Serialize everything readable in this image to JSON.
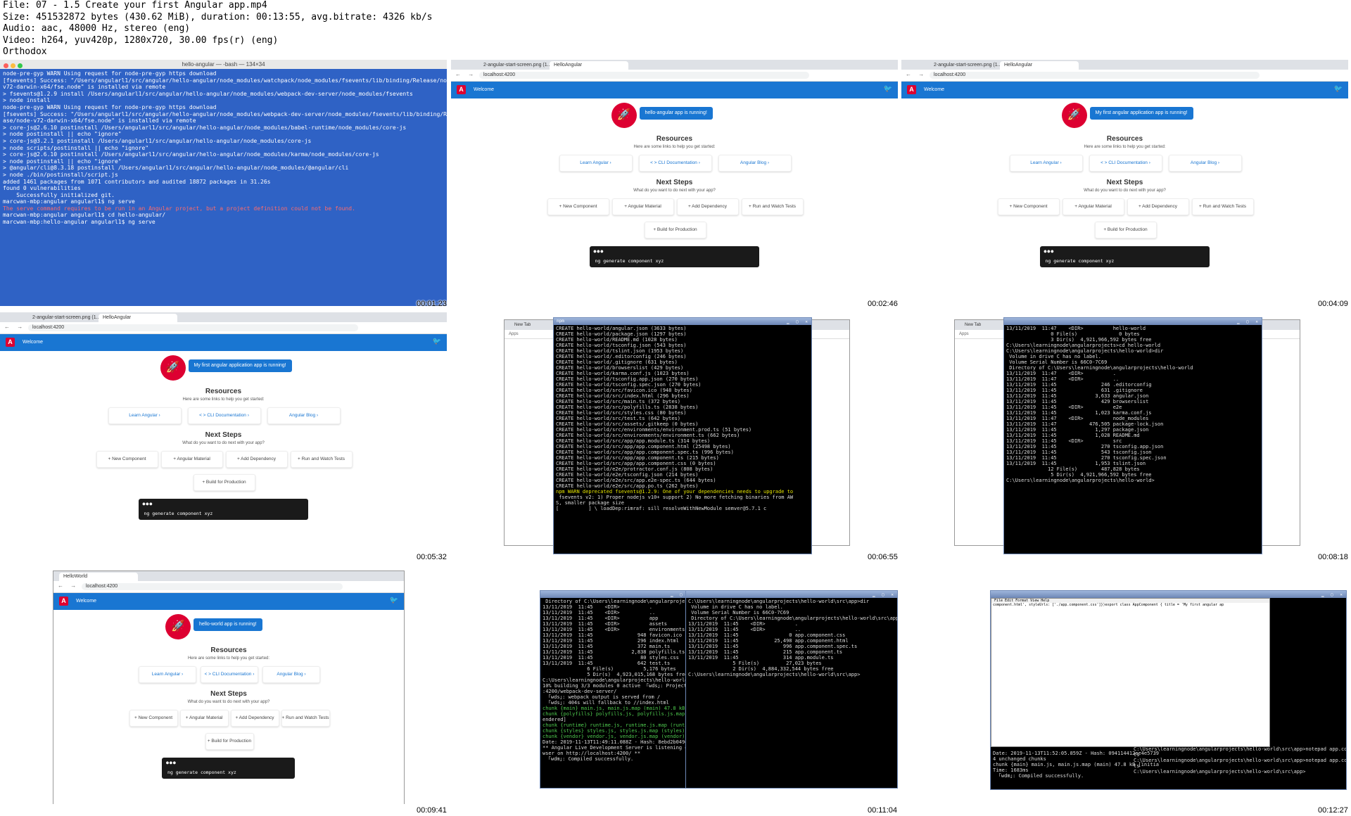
{
  "header": {
    "file": "File: 07 - 1.5 Create your first Angular app.mp4",
    "size": "Size: 451532872 bytes (430.62 MiB), duration: 00:13:55, avg.bitrate: 4326 kb/s",
    "audio": "Audio: aac, 48000 Hz, stereo (eng)",
    "video": "Video: h264, yuv420p, 1280x720, 30.00 fps(r) (eng)",
    "author": "Orthodox"
  },
  "timestamps": [
    "00:01:23",
    "00:02:46",
    "00:04:09",
    "00:05:32",
    "00:06:55",
    "00:08:18",
    "00:09:41",
    "00:11:04",
    "00:12:27"
  ],
  "terminal": {
    "title": "hello-angular — -bash — 134×34",
    "lines": [
      "node-pre-gyp WARN Using request for node-pre-gyp https download",
      "[fsevents] Success: \"/Users/angularl1/src/angular/hello-angular/node_modules/watchpack/node_modules/fsevents/lib/binding/Release/node-",
      "v72-darwin-x64/fse.node\" is installed via remote",
      "",
      "> fsevents@1.2.9 install /Users/angularl1/src/angular/hello-angular/node_modules/webpack-dev-server/node_modules/fsevents",
      "> node install",
      "",
      "node-pre-gyp WARN Using request for node-pre-gyp https download",
      "[fsevents] Success: \"/Users/angularl1/src/angular/hello-angular/node_modules/webpack-dev-server/node_modules/fsevents/lib/binding/Rele",
      "ase/node-v72-darwin-x64/fse.node\" is installed via remote",
      "",
      "> core-js@2.6.10 postinstall /Users/angularl1/src/angular/hello-angular/node_modules/babel-runtime/node_modules/core-js",
      "> node postinstall || echo \"ignore\"",
      "",
      "",
      "> core-js@3.2.1 postinstall /Users/angularl1/src/angular/hello-angular/node_modules/core-js",
      "> node scripts/postinstall || echo \"ignore\"",
      "",
      "",
      "> core-js@2.6.10 postinstall /Users/angularl1/src/angular/hello-angular/node_modules/karma/node_modules/core-js",
      "> node postinstall || echo \"ignore\"",
      "",
      "",
      "> @angular/cli@8.3.18 postinstall /Users/angularl1/src/angular/hello-angular/node_modules/@angular/cli",
      "> node ./bin/postinstall/script.js",
      "",
      "added 1461 packages from 1071 contributors and audited 18872 packages in 31.26s",
      "found 0 vulnerabilities",
      "",
      "    Successfully initialized git.",
      "marcwan-mbp:angular angularl1$ ng serve"
    ],
    "error": "The serve command requires to be run in an Angular project, but a project definition could not be found.",
    "tail": [
      "marcwan-mbp:angular angularl1$ cd hello-angular/",
      "marcwan-mbp:hello-angular angularl1$ ng serve"
    ]
  },
  "app": {
    "tab1": "2-angular-start-screen.png (1...",
    "tab2": "HelloAngular",
    "tab_hw": "HelloWorld",
    "url": "localhost:4200",
    "welcome": "Welcome",
    "running1": "hello-angular app is running!",
    "running2": "My first angular application app is running!",
    "running3": "hello-world app is running!",
    "resources": "Resources",
    "resources_sub": "Here are some links to help you get started:",
    "learn": "Learn Angular  ›",
    "cli": "< >  CLI Documentation  ›",
    "blog": "Angular Blog  ›",
    "next": "Next Steps",
    "next_sub": "What do you want to do next with your app?",
    "new_component": "+   New Component",
    "material": "+   Angular Material",
    "dependency": "+   Add Dependency",
    "tests": "+   Run and Watch Tests",
    "build": "+   Build for Production",
    "cmd": "ng generate component xyz"
  },
  "cmd5": {
    "title": "npm",
    "lines": [
      "CREATE hello-world/angular.json (3633 bytes)",
      "CREATE hello-world/package.json (1297 bytes)",
      "CREATE hello-world/README.md (1028 bytes)",
      "CREATE hello-world/tsconfig.json (543 bytes)",
      "CREATE hello-world/tslint.json (1953 bytes)",
      "CREATE hello-world/.editorconfig (246 bytes)",
      "CREATE hello-world/.gitignore (631 bytes)",
      "CREATE hello-world/browserslist (429 bytes)",
      "CREATE hello-world/karma.conf.js (1023 bytes)",
      "CREATE hello-world/tsconfig.app.json (270 bytes)",
      "CREATE hello-world/tsconfig.spec.json (270 bytes)",
      "CREATE hello-world/src/favicon.ico (948 bytes)",
      "CREATE hello-world/src/index.html (296 bytes)",
      "CREATE hello-world/src/main.ts (372 bytes)",
      "CREATE hello-world/src/polyfills.ts (2838 bytes)",
      "CREATE hello-world/src/styles.css (80 bytes)",
      "CREATE hello-world/src/test.ts (642 bytes)",
      "CREATE hello-world/src/assets/.gitkeep (0 bytes)",
      "CREATE hello-world/src/environments/environment.prod.ts (51 bytes)",
      "CREATE hello-world/src/environments/environment.ts (662 bytes)",
      "CREATE hello-world/src/app/app.module.ts (314 bytes)",
      "CREATE hello-world/src/app/app.component.html (25498 bytes)",
      "CREATE hello-world/src/app/app.component.spec.ts (996 bytes)",
      "CREATE hello-world/src/app/app.component.ts (215 bytes)",
      "CREATE hello-world/src/app/app.component.css (0 bytes)",
      "CREATE hello-world/e2e/protractor.conf.js (808 bytes)",
      "CREATE hello-world/e2e/tsconfig.json (214 bytes)",
      "CREATE hello-world/e2e/src/app.e2e-spec.ts (644 bytes)",
      "CREATE hello-world/e2e/src/app.po.ts (262 bytes)",
      "npm WARN deprecated fsevents@1.2.9: One of your dependencies needs to upgrade to",
      " fsevents v2: 1) Proper nodejs v10+ support 2) No more fetching binaries from AW",
      "S, smaller package size",
      "[          ] \\ loadDep:rimraf: sill resolveWithNewModule semver@5.7.1 c"
    ]
  },
  "cmd6": {
    "lines": [
      "13/11/2019  11:47    <DIR>          hello-world",
      "               0 File(s)              0 bytes",
      "               3 Dir(s)  4,921,966,592 bytes free",
      "",
      "C:\\Users\\learningnode\\angularprojects>cd hello-world",
      "",
      "C:\\Users\\learningnode\\angularprojects\\hello-world>dir",
      " Volume in drive C has no label.",
      " Volume Serial Number is 66C0-7C69",
      "",
      " Directory of C:\\Users\\learningnode\\angularprojects\\hello-world",
      "",
      "13/11/2019  11:47    <DIR>          .",
      "13/11/2019  11:47    <DIR>          ..",
      "13/11/2019  11:45               246 .editorconfig",
      "13/11/2019  11:45               631 .gitignore",
      "13/11/2019  11:45             3,633 angular.json",
      "13/11/2019  11:45               429 browserslist",
      "13/11/2019  11:45    <DIR>          e2e",
      "13/11/2019  11:45             1,023 karma.conf.js",
      "13/11/2019  11:47    <DIR>          node_modules",
      "13/11/2019  11:47           476,505 package-lock.json",
      "13/11/2019  11:45             1,297 package.json",
      "13/11/2019  11:45             1,028 README.md",
      "13/11/2019  11:45    <DIR>          src",
      "13/11/2019  11:45               270 tsconfig.app.json",
      "13/11/2019  11:45               543 tsconfig.json",
      "13/11/2019  11:45               270 tsconfig.spec.json",
      "13/11/2019  11:45             1,953 tslint.json",
      "              12 File(s)        487,828 bytes",
      "               5 Dir(s)  4,921,966,592 bytes free",
      "",
      "C:\\Users\\learningnode\\angularprojects\\hello-world>"
    ]
  },
  "cmd8a": {
    "lines": [
      " Directory of C:\\Users\\learningnode\\angularprojects\\hello",
      "",
      "13/11/2019  11:45    <DIR>          .",
      "13/11/2019  11:45    <DIR>          ..",
      "13/11/2019  11:45    <DIR>          app",
      "13/11/2019  11:45    <DIR>          assets",
      "13/11/2019  11:45    <DIR>          environments",
      "13/11/2019  11:45               948 favicon.ico",
      "13/11/2019  11:45               296 index.html",
      "13/11/2019  11:45               372 main.ts",
      "13/11/2019  11:45             2,838 polyfills.ts",
      "13/11/2019  11:45                80 styles.css",
      "13/11/2019  11:45               642 test.ts",
      "               6 File(s)          5,176 bytes",
      "               5 Dir(s)  4,923,015,168 bytes free",
      "",
      "C:\\Users\\learningnode\\angularprojects\\hello-world\\src>ng",
      "10% building 3/3 modules 0 active  ｢wds｣: Project is run",
      ":4200/webpack-dev-server/",
      "  ｢wds｣: webpack output is served from /",
      "  ｢wds｣: 404s will fallback to //index.html",
      "",
      "chunk {main} main.js, main.js.map (main) 47.8 kB [initia",
      "chunk {polyfills} polyfills.js, polyfills.js.map (polyf",
      "endered]",
      "chunk {runtime} runtime.js, runtime.js.map (runtime) 6.1",
      "chunk {styles} styles.js, styles.js.map (styles) 9.71 kB",
      "chunk {vendor} vendor.js, vendor.js.map (vendor) 3.81 MB",
      "Date: 2019-11-13T11:49:11.088Z - Hash: 8ebd2b049e0613b",
      "** Angular Live Development Server is listening on local",
      "wser on http://localhost:4200/ **",
      "  ｢wdm｣: Compiled successfully."
    ]
  },
  "cmd8b": {
    "lines": [
      "C:\\Users\\learningnode\\angularprojects\\hello-world\\src\\app>dir",
      " Volume in drive C has no label.",
      " Volume Serial Number is 66C0-7C69",
      "",
      " Directory of C:\\Users\\learningnode\\angularprojects\\hello-world\\src\\app",
      "",
      "13/11/2019  11:45    <DIR>          .",
      "13/11/2019  11:45    <DIR>          ..",
      "13/11/2019  11:45                 0 app.component.css",
      "13/11/2019  11:45            25,498 app.component.html",
      "13/11/2019  11:45               996 app.component.spec.ts",
      "13/11/2019  11:45               215 app.component.ts",
      "13/11/2019  11:45               314 app.module.ts",
      "               5 File(s)         27,023 bytes",
      "               2 Dir(s)  4,884,332,544 bytes free",
      "",
      "C:\\Users\\learningnode\\angularprojects\\hello-world\\src\\app>"
    ]
  },
  "cmd9": {
    "notepad_menu": "File  Edit  Format  View  Help",
    "notepad_line": "component.html',  styleUrls: ['./app.component.css']})export class AppComponent {  title = 'My first angular ap",
    "lines": [
      "Date: 2019-11-13T11:52:05.859Z - Hash: 094114412ee4e5739",
      "4 unchanged chunks",
      "chunk {main} main.js, main.js.map (main) 47.8 kB [initia",
      "Time: 1683ms",
      "  ｢wdm｣: Compiled successfully."
    ],
    "right": [
      "C:\\Users\\learningnode\\angularprojects\\hello-world\\src\\app>notepad app.component.",
      "ts",
      "C:\\Users\\learningnode\\angularprojects\\hello-world\\src\\app>notepad app.component.",
      "ts",
      "C:\\Users\\learningnode\\angularprojects\\hello-world\\src\\app>"
    ]
  }
}
